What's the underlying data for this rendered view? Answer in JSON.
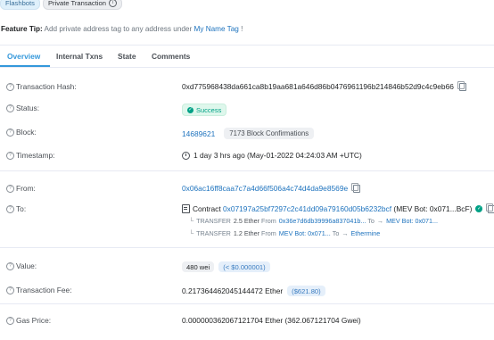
{
  "top_tags": {
    "flashbots": "Flashbots",
    "private": "Private Transaction",
    "private_info": "i"
  },
  "feature_tip": {
    "label": "Feature Tip:",
    "text": " Add private address tag to any address under ",
    "link": "My Name Tag",
    "end": " !"
  },
  "tabs": [
    {
      "label": "Overview"
    },
    {
      "label": "Internal Txns"
    },
    {
      "label": "State"
    },
    {
      "label": "Comments"
    }
  ],
  "rows": {
    "hash": {
      "label": "Transaction Hash:",
      "value": "0xd775968438da661ca8b19aa681a646d86b0476961196b214846b52d9c4c9eb66"
    },
    "status": {
      "label": "Status:",
      "value": "Success"
    },
    "block": {
      "label": "Block:",
      "value": "14689621",
      "confirmations": "7173 Block Confirmations"
    },
    "timestamp": {
      "label": "Timestamp:",
      "value": "1 day 3 hrs ago (May-01-2022 04:24:03 AM +UTC)"
    },
    "from": {
      "label": "From:",
      "value": "0x06ac16ff8caa7c7a4d66f506a4c74d4da9e8569e"
    },
    "to": {
      "label": "To:",
      "prefix": "Contract",
      "address": "0x07197a25bf7297c2c41dd09a79160d05b6232bcf",
      "name": "(MEV Bot: 0x071...BcF)",
      "transfers": [
        {
          "kw": "TRANSFER",
          "amount": "2.5 Ether",
          "from_kw": "From",
          "from": "0x36e7d6db39996a837041b...",
          "to_kw": "To",
          "to": "MEV Bot: 0x071..."
        },
        {
          "kw": "TRANSFER",
          "amount": "1.2 Ether",
          "from_kw": "From",
          "from": "MEV Bot: 0x071...",
          "to_kw": "To",
          "to": "Ethermine"
        }
      ]
    },
    "value": {
      "label": "Value:",
      "amount": "480 wei",
      "usd": "(< $0.000001)"
    },
    "fee": {
      "label": "Transaction Fee:",
      "value": "0.217364462045144472 Ether",
      "usd": "($621.80)"
    },
    "gas": {
      "label": "Gas Price:",
      "value": "0.000000362067121704 Ether (362.067121704 Gwei)"
    }
  },
  "colors": {
    "accent": "#3498db",
    "link": "#1e73be",
    "success": "#00a186",
    "divider": "#e7eaf3"
  }
}
